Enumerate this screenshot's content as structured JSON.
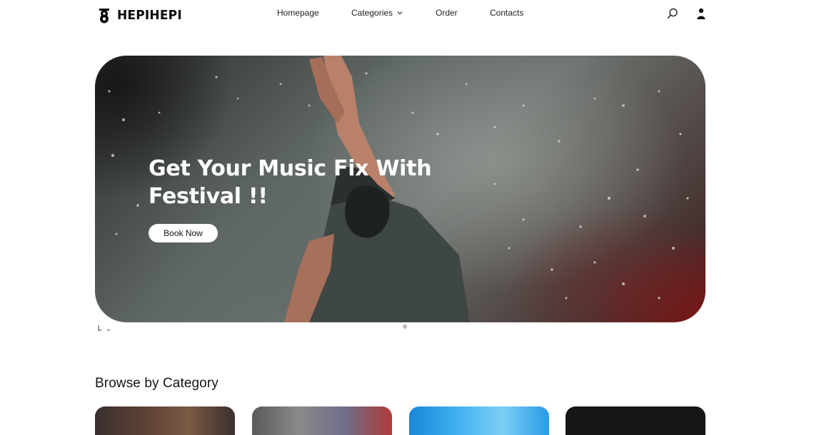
{
  "brand": {
    "name": "HEPIHEPI",
    "logo_icon": "eight-badge-icon"
  },
  "nav": {
    "items": [
      {
        "label": "Homepage"
      },
      {
        "label": "Categories",
        "has_dropdown": true
      },
      {
        "label": "Order"
      },
      {
        "label": "Contacts"
      }
    ],
    "search_icon": "search-icon",
    "user_icon": "user-icon"
  },
  "hero": {
    "title_line1": "Get Your Music Fix With",
    "title_line2": "Festival !!",
    "cta_label": "Book Now",
    "slide_count": 1,
    "active_slide": 1
  },
  "categories": {
    "title": "Browse by Category",
    "cards": [
      {
        "icon": "concert-image"
      },
      {
        "icon": "stage-image"
      },
      {
        "icon": "sky-image"
      },
      {
        "icon": "dark-image"
      }
    ]
  },
  "colors": {
    "text": "#111111",
    "hero_accent": "#8c1414",
    "button_bg": "#ffffff",
    "dot": "#b7b7b7"
  }
}
